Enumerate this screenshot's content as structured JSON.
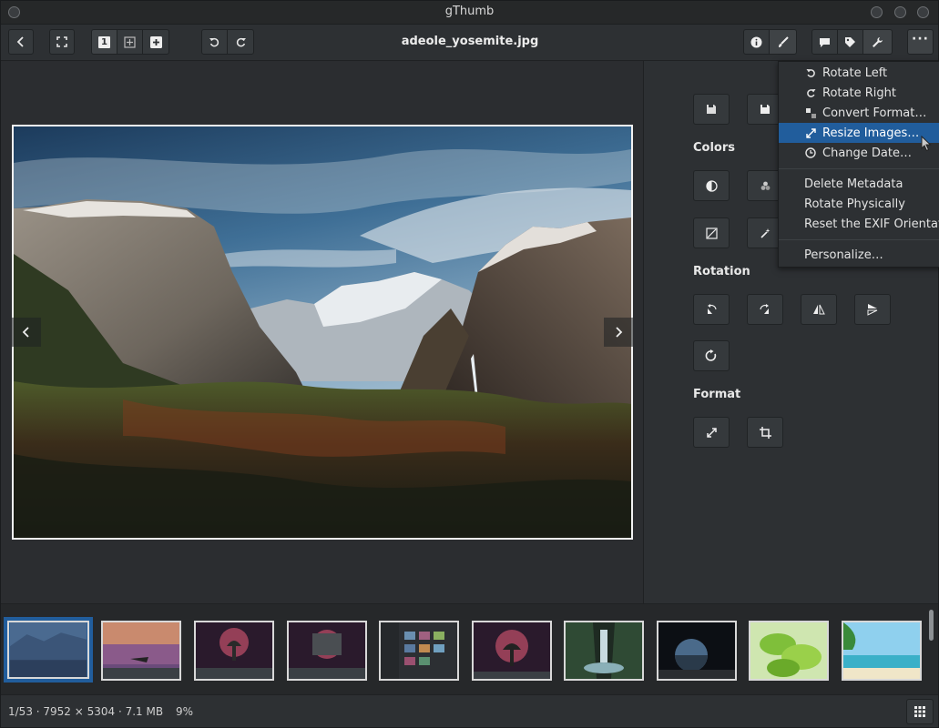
{
  "window": {
    "title": "gThumb"
  },
  "header": {
    "filename": "adeole_yosemite.jpg",
    "view_single_label": "1"
  },
  "panel": {
    "colors_title": "Colors",
    "rotation_title": "Rotation",
    "format_title": "Format"
  },
  "menu": {
    "items": [
      {
        "label": "Rotate Left",
        "icon": "rotate-left-icon"
      },
      {
        "label": "Rotate Right",
        "icon": "rotate-right-icon"
      },
      {
        "label": "Convert Format…",
        "icon": "convert-format-icon"
      },
      {
        "label": "Resize Images…",
        "icon": "resize-icon",
        "highlighted": true
      },
      {
        "label": "Change Date…",
        "icon": "clock-icon"
      }
    ],
    "plain_items": [
      {
        "label": "Delete Metadata"
      },
      {
        "label": "Rotate Physically"
      },
      {
        "label": "Reset the EXIF Orientation"
      },
      {
        "label": "Personalize…"
      }
    ]
  },
  "status": {
    "info": "1/53  ·  7952 × 5304  ·  7.1 MB",
    "zoom": "9%"
  },
  "colors": {
    "accent": "#215d9c",
    "background": "#2d3033"
  }
}
